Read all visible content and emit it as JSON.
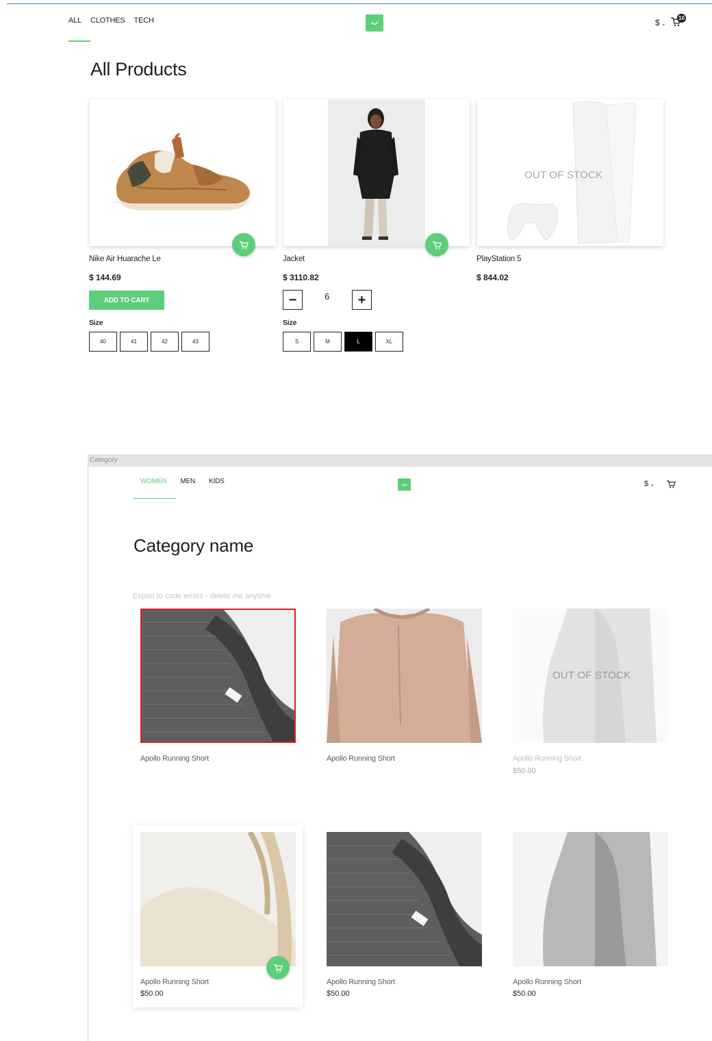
{
  "header": {
    "nav": [
      "ALL",
      "CLOTHES",
      "TECH"
    ],
    "currency": "$",
    "cart_count": "10"
  },
  "page": {
    "title": "All Products"
  },
  "products": [
    {
      "name": "Nike Air Huarache Le",
      "price": "$ 144.69",
      "add_to_cart": "ADD TO CART",
      "size_label": "Size",
      "sizes": [
        "40",
        "41",
        "42",
        "43"
      ]
    },
    {
      "name": "Jacket",
      "price": "$ 3110.82",
      "quantity": "6",
      "minus": "−",
      "plus": "+",
      "size_label": "Size",
      "sizes": [
        "S",
        "M",
        "L",
        "XL"
      ],
      "selected_size": "L"
    },
    {
      "name": "PlayStation 5",
      "price": "$ 844.02",
      "stock_label": "OUT OF STOCK"
    }
  ],
  "frame": {
    "label": "Category",
    "nav": [
      "WOMEN",
      "MEN",
      "KIDS"
    ],
    "active_nav": "WOMEN",
    "currency": "$",
    "title": "Category name",
    "ghost_text": "Export to code errors - delete me anytime",
    "tiles": [
      {
        "name": "Apollo Running Short",
        "price": "",
        "image": "grey-knit-sweater"
      },
      {
        "name": "Apollo Running Short",
        "price": "",
        "image": "pink-sweater"
      },
      {
        "name": "Apollo Running Short",
        "price": "$50.00",
        "image": "grey-dress",
        "stock_label": "OUT OF STOCK"
      },
      {
        "name": "Apollo Running Short",
        "price": "$50.00",
        "image": "cream-bag"
      },
      {
        "name": "Apollo Running Short",
        "price": "$50.00",
        "image": "grey-knit-sweater"
      },
      {
        "name": "Apollo Running Short",
        "price": "$50.00",
        "image": "grey-dress"
      }
    ]
  },
  "colors": {
    "accent": "#5ece7b",
    "text": "#1d1f22",
    "selection": "#d92020"
  }
}
